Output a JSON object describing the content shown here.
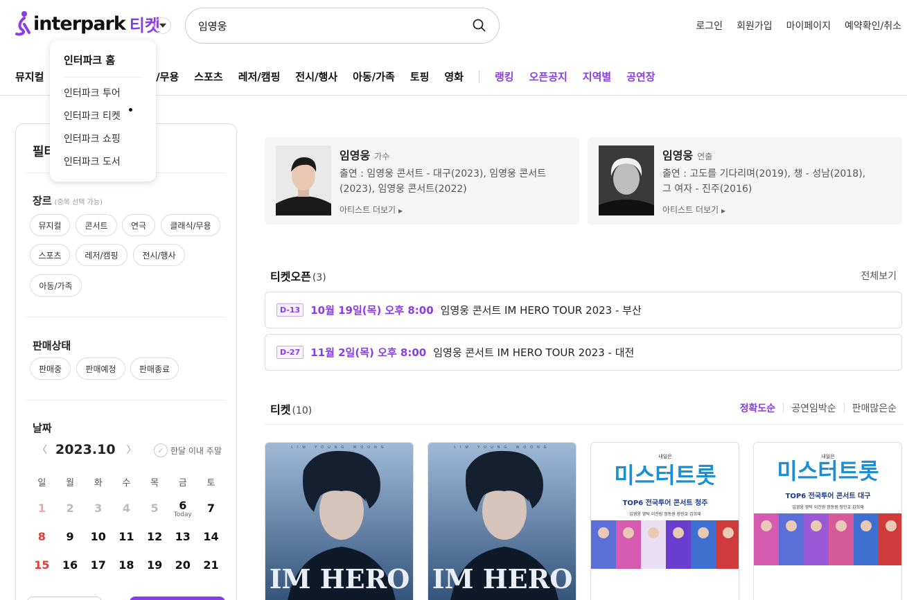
{
  "header": {
    "logo_text": "interpark",
    "logo_ticket": "티켓",
    "search_value": "임영웅",
    "links": [
      "로그인",
      "회원가입",
      "마이페이지",
      "예약확인/취소"
    ]
  },
  "gnb": {
    "items": [
      "뮤지컬",
      "식/무용",
      "스포츠",
      "레저/캠핑",
      "전시/행사",
      "아동/가족",
      "토핑",
      "영화"
    ],
    "highlight": [
      "랭킹",
      "오픈공지",
      "지역별",
      "공연장"
    ]
  },
  "dropdown": {
    "title": "인터파크 홈",
    "items": [
      "인터파크 투어",
      "인터파크 티켓",
      "인터파크 쇼핑",
      "인터파크 도서"
    ]
  },
  "filter": {
    "title_visible": "필터",
    "genre_label": "장르",
    "genre_note": "(중복 선택 가능)",
    "genres": [
      "뮤지컬",
      "콘서트",
      "연극",
      "클래식/무용",
      "스포츠",
      "레저/캠핑",
      "전시/행사",
      "아동/가족"
    ],
    "status_label": "판매상태",
    "statuses": [
      "판매중",
      "판매예정",
      "판매종료"
    ],
    "date_label": "날짜",
    "month": "2023.10",
    "weekend_label": "한달 이내 주말",
    "weekdays": [
      "일",
      "월",
      "화",
      "수",
      "목",
      "금",
      "토"
    ],
    "weeks": [
      [
        "1",
        "2",
        "3",
        "4",
        "5",
        "6",
        "7"
      ],
      [
        "8",
        "9",
        "10",
        "11",
        "12",
        "13",
        "14"
      ],
      [
        "15",
        "16",
        "17",
        "18",
        "19",
        "20",
        "21"
      ]
    ],
    "today_label": "Today"
  },
  "artists": [
    {
      "name": "임영웅",
      "role": "가수",
      "desc": "출연 : 임영웅 콘서트 - 대구(2023), 임영웅 콘서트(2023), 임영웅 콘서트(2022)",
      "more": "아티스트 더보기"
    },
    {
      "name": "임영웅",
      "role": "연출",
      "desc": "출연 : 고도를 기다리며(2019), 챙 - 성남(2018), 그 여자 - 진주(2016)",
      "more": "아티스트 더보기"
    }
  ],
  "ticket_open": {
    "title": "티켓오픈",
    "count": "(3)",
    "view_all": "전체보기",
    "rows": [
      {
        "badge": "D-13",
        "date": "10월 19일(목) 오후 8:00",
        "title": "임영웅 콘서트 IM HERO TOUR 2023 - 부산"
      },
      {
        "badge": "D-27",
        "date": "11월 2일(목) 오후 8:00",
        "title": "임영웅 콘서트 IM HERO TOUR 2023 - 대전"
      }
    ]
  },
  "tickets": {
    "title": "티켓",
    "count": "(10)",
    "sort": [
      "정확도순",
      "공연임박순",
      "판매많은순"
    ],
    "posters": [
      {
        "top_text": "LIM YOUNG WOONG",
        "big": "IM HERO"
      },
      {
        "top_text": "LIM YOUNG WOONG",
        "big": "IM HERO"
      },
      {
        "pre": "내일은",
        "big": "미스터트롯",
        "sub": "TOP6 전국투어 콘서트 청주",
        "names": "임영웅 영탁 이찬원 정동원 장민호 김희재"
      },
      {
        "pre": "내일은",
        "big": "미스터트롯",
        "sub": "TOP6 전국투어 콘서트 대구",
        "names": "임영웅 영탁 이찬원 정동원 장민호 김희재"
      }
    ]
  },
  "colors": {
    "accent": "#8a3ce6",
    "red": "#e53935"
  }
}
